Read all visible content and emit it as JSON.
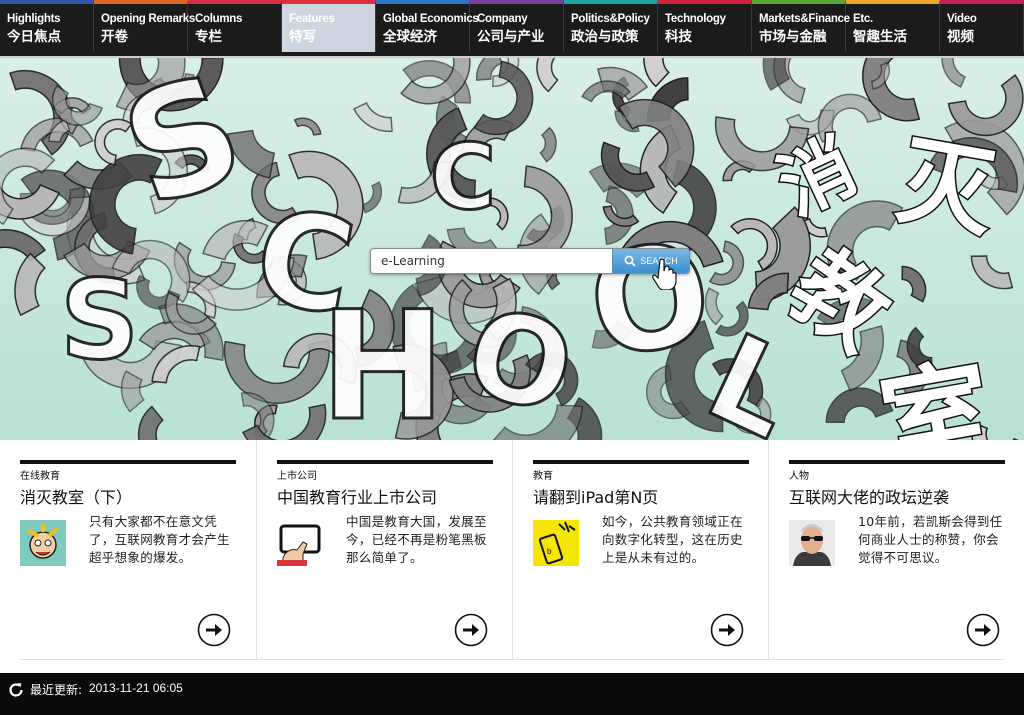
{
  "nav": {
    "items": [
      {
        "en": "Highlights",
        "zh": "今日焦点",
        "color": "#2f55a4",
        "active": false
      },
      {
        "en": "Opening Remarks",
        "zh": "开卷",
        "color": "#e0652a",
        "active": false
      },
      {
        "en": "Columns",
        "zh": "专栏",
        "color": "#d9304a",
        "active": false
      },
      {
        "en": "Features",
        "zh": "特写",
        "color": "#e03040",
        "active": true
      },
      {
        "en": "Global Economics",
        "zh": "全球经济",
        "color": "#2a77c4",
        "active": false
      },
      {
        "en": "Company",
        "zh": "公司与产业",
        "color": "#7a3f9a",
        "active": false
      },
      {
        "en": "Politics&Policy",
        "zh": "政治与政策",
        "color": "#1aa5a0",
        "active": false
      },
      {
        "en": "Technology",
        "zh": "科技",
        "color": "#d0203a",
        "active": false
      },
      {
        "en": "Markets&Finance",
        "zh": "市场与金融",
        "color": "#5aa63a",
        "active": false
      },
      {
        "en": "Etc.",
        "zh": "智趣生活",
        "color": "#f0a428",
        "active": false
      },
      {
        "en": "Video",
        "zh": "视频",
        "color": "#c3205a",
        "active": false
      }
    ]
  },
  "hero": {
    "search_value": "e-Learning",
    "search_button": "SEARCH",
    "title_chars": [
      "消",
      "灭",
      "教",
      "室"
    ],
    "bg_letters": "SCHOOL"
  },
  "articles": [
    {
      "category": "在线教育",
      "title": "消灭教室（下）",
      "excerpt": "只有大家都不在意文凭了，互联网教育才会产生超乎想象的爆发。",
      "thumb": "cartoon-face-thumbnail"
    },
    {
      "category": "上市公司",
      "title": "中国教育行业上市公司",
      "excerpt": "中国是教育大国，发展至今，已经不再是粉笔黑板那么简单了。",
      "thumb": "hand-tablet-thumbnail"
    },
    {
      "category": "教育",
      "title": "请翻到iPad第N页",
      "excerpt": "如今，公共教育领域正在向数字化转型，这在历史上是从未有过的。",
      "thumb": "phone-yellow-thumbnail"
    },
    {
      "category": "人物",
      "title": "互联网大佬的政坛逆袭",
      "excerpt": "10年前，若凯斯会得到任何商业人士的称赞，你会觉得不可思议。",
      "thumb": "man-sunglasses-thumbnail"
    }
  ],
  "footer": {
    "update_label": "最近更新:",
    "update_time": "2013-11-21 06:05"
  }
}
